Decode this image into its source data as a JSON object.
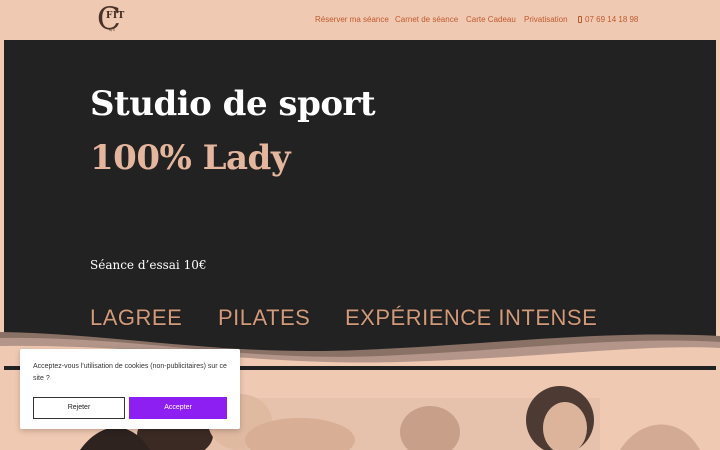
{
  "header": {
    "logo": {
      "main": "FIT",
      "sub": "by C"
    },
    "nav": [
      {
        "label": "Réserver ma séance"
      },
      {
        "label": "Carnet de séance"
      },
      {
        "label": "Carte Cadeau"
      },
      {
        "label": "Privatisation"
      },
      {
        "label": "07 69 14 18 98",
        "icon": "phone-icon"
      }
    ]
  },
  "hero": {
    "title": "Studio de sport",
    "subtitle": "100% Lady",
    "trial": "Séance d’essai 10€",
    "tags": [
      "LAGREE",
      "PILATES",
      "EXPÉRIENCE INTENSE"
    ]
  },
  "cookie": {
    "text": "Acceptez-vous l'utilisation de cookies (non-publicitaires) sur ce site ?",
    "reject_label": "Rejeter",
    "accept_label": "Accepter"
  },
  "colors": {
    "page_bg": "#f0c9b2",
    "hero_bg": "#232222",
    "accent_text": "#e5b69e",
    "tag_color": "#d19a7a",
    "nav_color": "#bf5a2e",
    "accept_button": "#8d1ff2"
  }
}
